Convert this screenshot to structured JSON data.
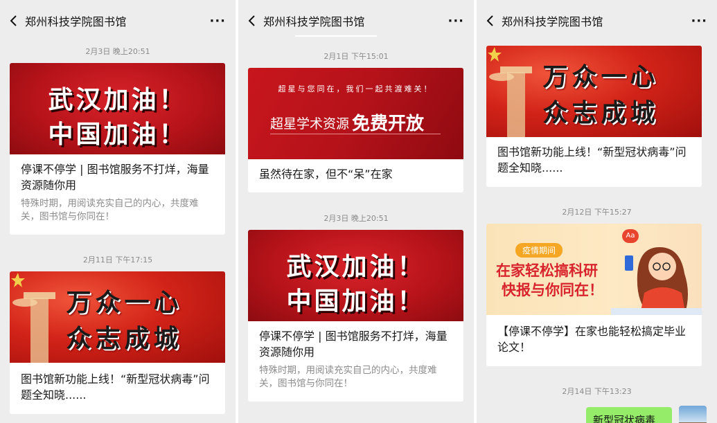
{
  "app_title": "郑州科技学院图书馆",
  "more_icon": "more-dots-icon",
  "panels": [
    {
      "items": [
        {
          "time": "2月3日 晚上20:51",
          "banner_line1": "武汉加油！",
          "banner_line2": "中国加油！",
          "title": "停课不停学 | 图书馆服务不打烊，海量资源随你用",
          "desc": "特殊时期，用阅读充实自己的内心，共度难关，图书馆与你同在！"
        },
        {
          "time": "2月11日 下午17:15",
          "banner_line1": "万众一心",
          "banner_line2": "众志成城",
          "title": "图书馆新功能上线！“新型冠状病毒”问题全知晓......"
        }
      ]
    },
    {
      "items": [
        {
          "time": "2月1日 下午15:01",
          "banner_sub": "超星与您同在，我们一起共渡难关！",
          "banner_left": "超星学术资源",
          "banner_right": "免费开放",
          "title": "虽然待在家，但不“呆”在家"
        },
        {
          "time": "2月3日 晚上20:51",
          "banner_line1": "武汉加油！",
          "banner_line2": "中国加油！",
          "title": "停课不停学 | 图书馆服务不打烊，海量资源随你用",
          "desc": "特殊时期，用阅读充实自己的内心，共度难关，图书馆与你同在！"
        }
      ]
    },
    {
      "items": [
        {
          "banner_line1": "万众一心",
          "banner_line2": "众志成城",
          "title": "图书馆新功能上线！“新型冠状病毒”问题全知晓......"
        },
        {
          "time": "2月12日 下午15:27",
          "banner_tag": "疫情期间",
          "banner_line1": "在家轻松搞科研",
          "banner_line2": "快报与你同在！",
          "banner_bubble": "Aa",
          "title": "【停课不停学】在家也能轻松搞定毕业论文！"
        },
        {
          "time": "2月14日 下午13:23",
          "bubble": "新型冠状病毒"
        }
      ]
    }
  ]
}
